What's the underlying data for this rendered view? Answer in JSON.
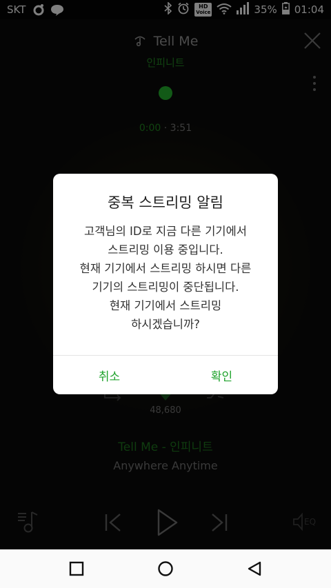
{
  "status_bar": {
    "carrier": "SKT",
    "hd_label_top": "HD",
    "hd_label_bottom": "Voice",
    "battery": "35%",
    "time": "01:04"
  },
  "player": {
    "song_title_top": "Tell Me",
    "artist_top": "인피니트",
    "current_time": "0:00",
    "separator": "·",
    "duration": "3:51",
    "like_count": "48,680",
    "song_title_artist": "Tell Me - 인피니트",
    "album": "Anywhere Anytime",
    "eq_label": "EQ",
    "colors": {
      "accent_green": "#22a52a",
      "dim_green": "#1c6e1c"
    }
  },
  "dialog": {
    "title": "중복 스트리밍 알림",
    "message_lines": [
      "고객님의 ID로 지금 다른 기기에서",
      "스트리밍 이용 중입니다.",
      "현재 기기에서 스트리밍 하시면 다른",
      "기기의 스트리밍이 중단됩니다.",
      "현재 기기에서 스트리밍",
      "하시겠습니까?"
    ],
    "cancel_label": "취소",
    "confirm_label": "확인"
  },
  "icons": {
    "close": "close-icon",
    "more": "more-vert-icon",
    "playlist": "playlist-icon",
    "prev": "skip-previous-icon",
    "play": "play-icon",
    "next": "skip-next-icon",
    "eq": "equalizer-icon",
    "nav_recents": "recents-icon",
    "nav_home": "home-icon",
    "nav_back": "back-icon"
  }
}
